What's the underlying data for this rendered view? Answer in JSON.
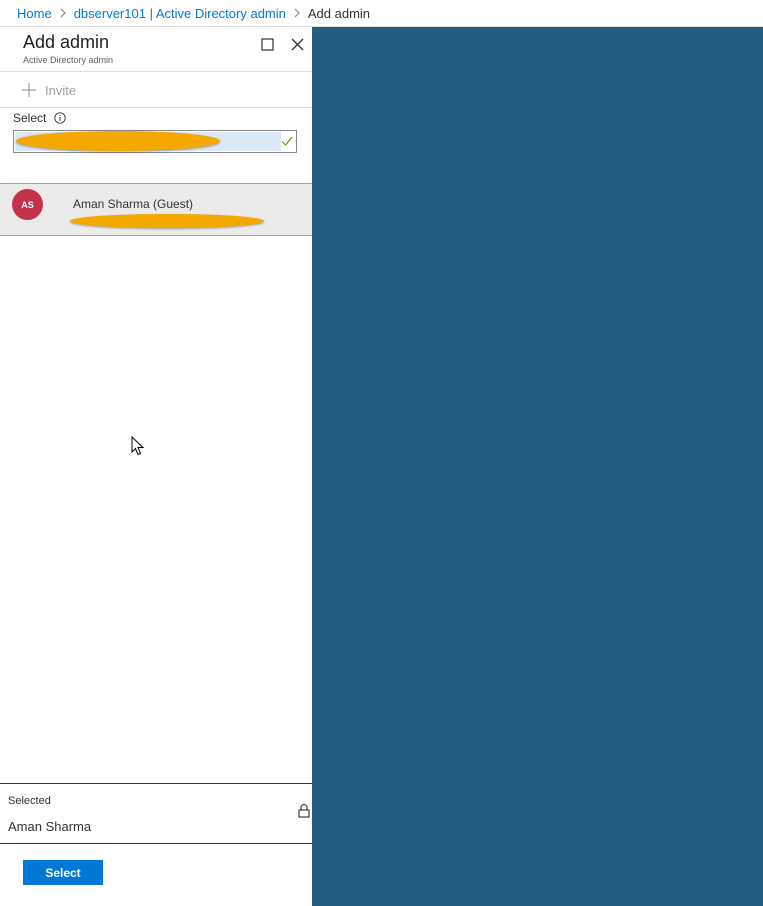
{
  "breadcrumb": {
    "items": [
      "Home",
      "dbserver101 | Active Directory admin"
    ],
    "current": "Add admin"
  },
  "blade": {
    "title": "Add admin",
    "subtitle": "Active Directory admin",
    "toolbar": {
      "invite_label": "Invite"
    },
    "select": {
      "label": "Select",
      "value": "",
      "status": "valid"
    },
    "results": [
      {
        "initials": "AS",
        "name": "Aman Sharma (Guest)",
        "avatar_color": "#c4314b"
      }
    ],
    "selected": {
      "label": "Selected",
      "value": "Aman Sharma"
    },
    "action_button": "Select"
  },
  "colors": {
    "accent": "#0078d4",
    "backdrop": "#245c7f",
    "redaction": "#f5a800"
  },
  "icons": [
    "chevron-right-icon",
    "maximize-icon",
    "close-icon",
    "plus-icon",
    "info-icon",
    "check-icon",
    "lock-icon",
    "mouse-cursor-icon"
  ]
}
